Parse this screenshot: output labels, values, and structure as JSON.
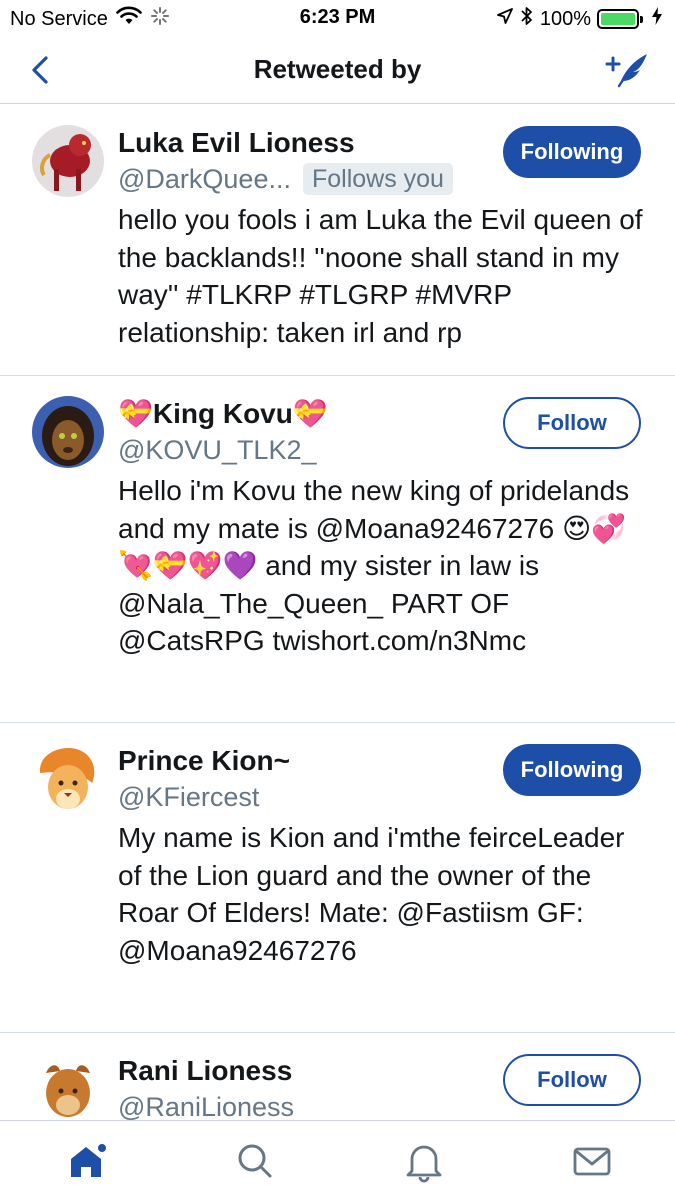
{
  "status_bar": {
    "carrier": "No Service",
    "time": "6:23 PM",
    "battery": "100%",
    "battery_level": 1.0
  },
  "nav": {
    "title": "Retweeted by"
  },
  "users": [
    {
      "name": "Luka Evil Lioness",
      "handle": "@DarkQuee...",
      "follows_you": "Follows you",
      "button": "Following",
      "bio": "hello you fools i am Luka the Evil queen of the backlands!! ''noone shall stand in my way'' #TLKRP #TLGRP #MVRP relationship: taken irl and rp"
    },
    {
      "name": "💝King Kovu💝",
      "handle": "@KOVU_TLK2_",
      "button": "Follow",
      "bio": "Hello i'm Kovu the new king of pridelands and my mate is @Moana92467276 😍💞💘💝💖💜 and my sister in law is @Nala_The_Queen_ PART OF @CatsRPG twishort.com/n3Nmc"
    },
    {
      "name": "Prince Kion~",
      "handle": "@KFiercest",
      "button": "Following",
      "bio": "My name is Kion and i'mthe feirceLeader of the Lion guard and the owner of the Roar Of Elders! Mate: @Fastiism GF: @Moana92467276"
    },
    {
      "name": "Rani Lioness",
      "handle": "@RaniLioness",
      "button": "Follow",
      "bio": ""
    }
  ],
  "icons": {
    "back": "chevron-left-icon",
    "compose": "add-tweet-icon",
    "tabs": [
      "home-icon",
      "search-icon",
      "notifications-icon",
      "messages-icon"
    ]
  },
  "colors": {
    "accent": "#1d4ea8",
    "secondary_text": "#657786"
  }
}
